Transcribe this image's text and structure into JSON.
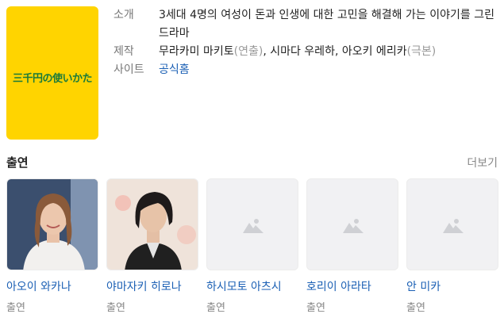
{
  "poster": {
    "logo_text": "三千円の使いかた",
    "bg_color": "#ffd400",
    "text_color": "#1a7a3a"
  },
  "info": {
    "intro_label": "소개",
    "intro_value": "3세대 4명의 여성이 돈과 인생에 대한 고민을 해결해 가는 이야기를 그린 드라마",
    "production_label": "제작",
    "production_director": "무라카미 마키토",
    "production_director_role": "(연출)",
    "production_writers": ", 시마다 우레하, 아오키 에리카",
    "production_writers_role": "(극본)",
    "site_label": "사이트",
    "site_link": "공식홈"
  },
  "cast": {
    "title": "출연",
    "more": "더보기",
    "members": [
      {
        "name": "아오이 와카나",
        "role": "출연",
        "photo": "person-photo"
      },
      {
        "name": "야마자키 히로나",
        "role": "출연",
        "photo": "person-photo"
      },
      {
        "name": "하시모토 아츠시",
        "role": "출연",
        "photo": "image-placeholder-icon"
      },
      {
        "name": "호리이 아라타",
        "role": "출연",
        "photo": "image-placeholder-icon"
      },
      {
        "name": "안 미카",
        "role": "출연",
        "photo": "image-placeholder-icon"
      }
    ]
  },
  "colors": {
    "link": "#1a5fb4",
    "label": "#777777",
    "placeholder_bg": "#f1f1f3"
  }
}
